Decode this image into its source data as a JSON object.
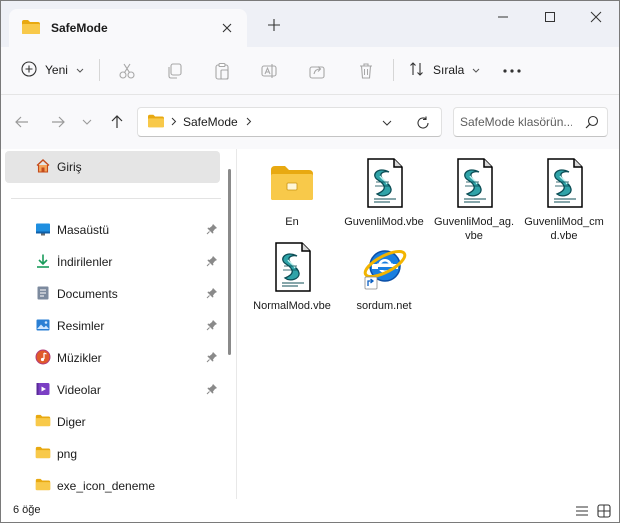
{
  "window": {
    "tab_title": "SafeMode"
  },
  "toolbar": {
    "new_label": "Yeni",
    "sort_label": "Sırala"
  },
  "address": {
    "path": "SafeMode"
  },
  "search": {
    "placeholder": "SafeMode klasörün..."
  },
  "sidebar": {
    "home_label": "Giriş",
    "items": [
      {
        "label": "Masaüstü",
        "icon": "desktop-icon",
        "pinned": true
      },
      {
        "label": "İndirilenler",
        "icon": "download-icon",
        "pinned": true
      },
      {
        "label": "Documents",
        "icon": "documents-icon",
        "pinned": true
      },
      {
        "label": "Resimler",
        "icon": "pictures-icon",
        "pinned": true
      },
      {
        "label": "Müzikler",
        "icon": "music-icon",
        "pinned": true
      },
      {
        "label": "Videolar",
        "icon": "videos-icon",
        "pinned": true
      },
      {
        "label": "Diger",
        "icon": "folder-icon",
        "pinned": false
      },
      {
        "label": "png",
        "icon": "folder-icon",
        "pinned": false
      },
      {
        "label": "exe_icon_deneme",
        "icon": "folder-icon",
        "pinned": false
      }
    ]
  },
  "files": [
    {
      "name": "En",
      "type": "folder"
    },
    {
      "name": "GuvenliMod.vbe",
      "type": "vbe-script"
    },
    {
      "name": "GuvenliMod_ag.vbe",
      "type": "vbe-script"
    },
    {
      "name": "GuvenliMod_cmd.vbe",
      "type": "vbe-script"
    },
    {
      "name": "NormalMod.vbe",
      "type": "vbe-script"
    },
    {
      "name": "sordum.net",
      "type": "internet-shortcut"
    }
  ],
  "status": {
    "item_count": "6 öğe"
  },
  "colors": {
    "folder_yellow": "#f8c94a",
    "accent_blue": "#0067c0",
    "selection_gray": "#e5e5e5"
  }
}
